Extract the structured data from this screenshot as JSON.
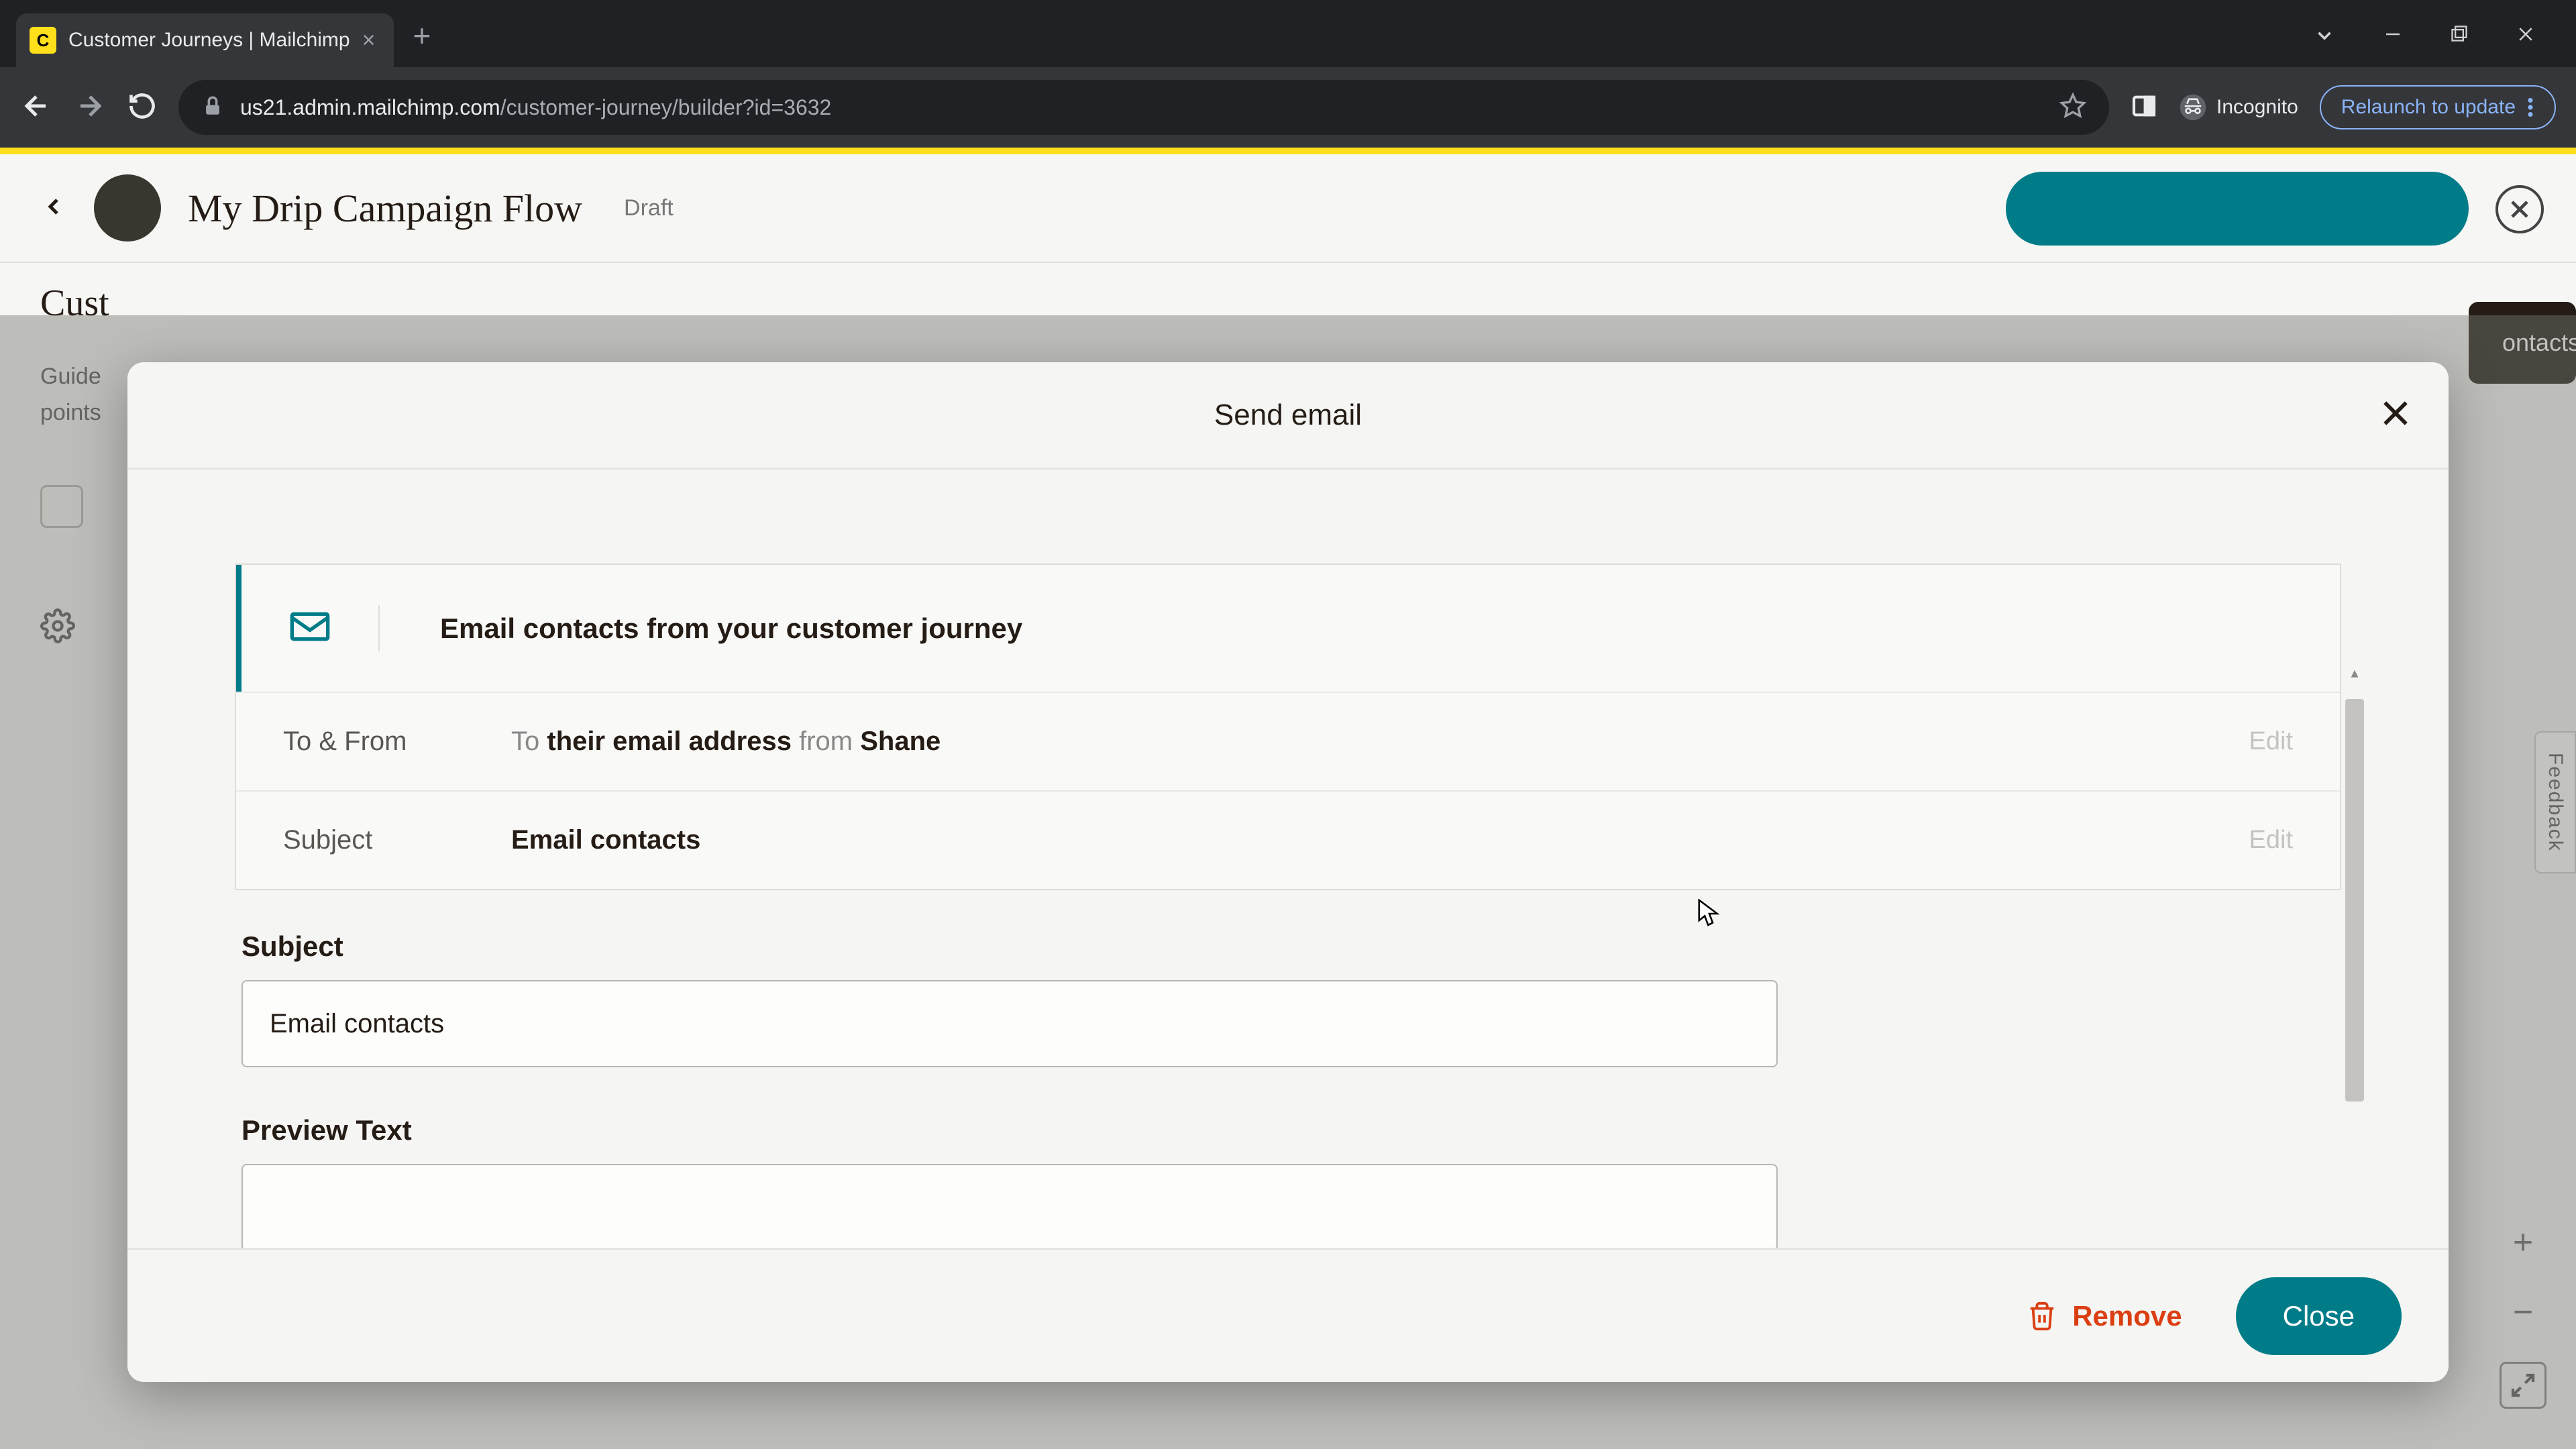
{
  "browser": {
    "tab_title": "Customer Journeys | Mailchimp",
    "favicon_letter": "C",
    "url_host": "us21.admin.mailchimp.com",
    "url_path": "/customer-journey/builder?id=3632",
    "incognito_label": "Incognito",
    "relaunch_label": "Relaunch to update"
  },
  "background": {
    "title": "My Drip Campaign Flow",
    "status": "Draft",
    "side_heading": "Cust",
    "side_desc_1": "Guide",
    "side_desc_2": "points",
    "contacts_tip": "ontacts b",
    "feedback": "Feedback"
  },
  "modal": {
    "title": "Send email",
    "banner": "Email contacts from your customer journey",
    "to_from_label": "To & From",
    "to_prefix": "To",
    "to_value": "their email address",
    "from_prefix": "from",
    "from_value": "Shane",
    "subject_row_label": "Subject",
    "subject_row_value": "Email contacts",
    "edit_label": "Edit",
    "subject_field_label": "Subject",
    "subject_field_value": "Email contacts",
    "preview_field_label": "Preview Text",
    "preview_field_value": "",
    "remove_label": "Remove",
    "close_label": "Close"
  }
}
